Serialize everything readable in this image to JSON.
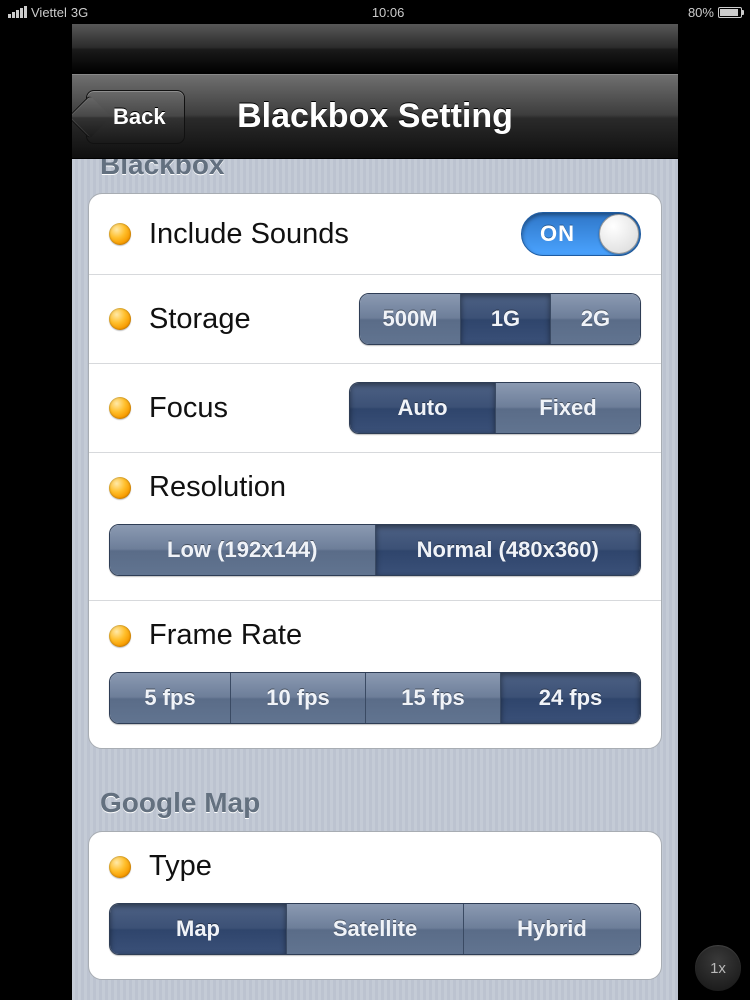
{
  "status": {
    "carrier": "Viettel",
    "network": "3G",
    "time": "10:06",
    "battery": "80%"
  },
  "nav": {
    "back": "Back",
    "title": "Blackbox Setting"
  },
  "sections": {
    "blackbox": {
      "header": "Blackbox",
      "includeSounds": {
        "label": "Include Sounds",
        "toggleText": "ON"
      },
      "storage": {
        "label": "Storage",
        "options": [
          "500M",
          "1G",
          "2G"
        ],
        "selected": "1G"
      },
      "focus": {
        "label": "Focus",
        "options": [
          "Auto",
          "Fixed"
        ],
        "selected": "Auto"
      },
      "resolution": {
        "label": "Resolution",
        "options": [
          "Low (192x144)",
          "Normal (480x360)"
        ],
        "selected": "Normal (480x360)"
      },
      "frameRate": {
        "label": "Frame Rate",
        "options": [
          "5 fps",
          "10 fps",
          "15 fps",
          "24 fps"
        ],
        "selected": "24 fps"
      }
    },
    "googleMap": {
      "header": "Google Map",
      "type": {
        "label": "Type",
        "options": [
          "Map",
          "Satellite",
          "Hybrid"
        ],
        "selected": "Map"
      }
    }
  },
  "zoom": "1x"
}
